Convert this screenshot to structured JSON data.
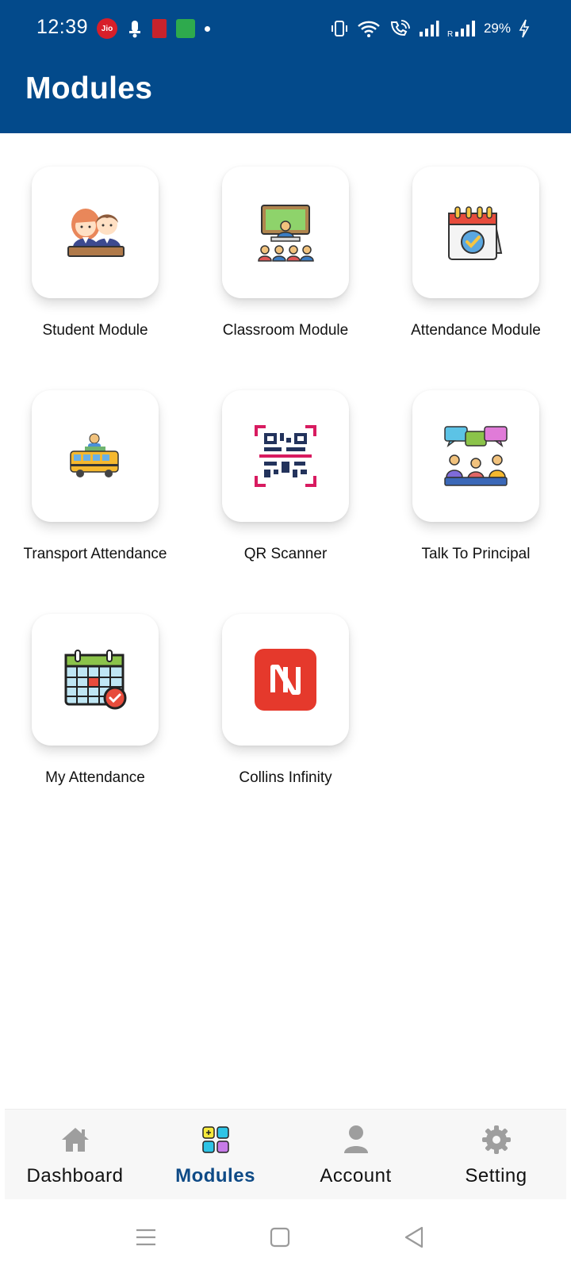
{
  "status_bar": {
    "time": "12:39",
    "jio_label": "Jio",
    "battery": "29%"
  },
  "app_bar": {
    "title": "Modules"
  },
  "modules": [
    {
      "label": "Student Module",
      "icon": "students-icon"
    },
    {
      "label": "Classroom Module",
      "icon": "classroom-icon"
    },
    {
      "label": "Attendance Module",
      "icon": "attendance-calendar-icon"
    },
    {
      "label": "Transport Attendance",
      "icon": "school-bus-icon"
    },
    {
      "label": "QR Scanner",
      "icon": "qr-scanner-icon"
    },
    {
      "label": "Talk To Principal",
      "icon": "meeting-chat-icon"
    },
    {
      "label": "My Attendance",
      "icon": "calendar-check-icon"
    },
    {
      "label": "Collins Infinity",
      "icon": "collins-infinity-logo-icon"
    }
  ],
  "bottom_nav": {
    "items": [
      {
        "label": "Dashboard",
        "icon": "home-icon"
      },
      {
        "label": "Modules",
        "icon": "modules-grid-icon",
        "active": true
      },
      {
        "label": "Account",
        "icon": "person-icon"
      },
      {
        "label": "Setting",
        "icon": "gear-icon"
      }
    ]
  },
  "colors": {
    "primary": "#034a8b",
    "active_nav": "#0e4a86",
    "nav_icon_inactive": "#9e9e9e"
  }
}
